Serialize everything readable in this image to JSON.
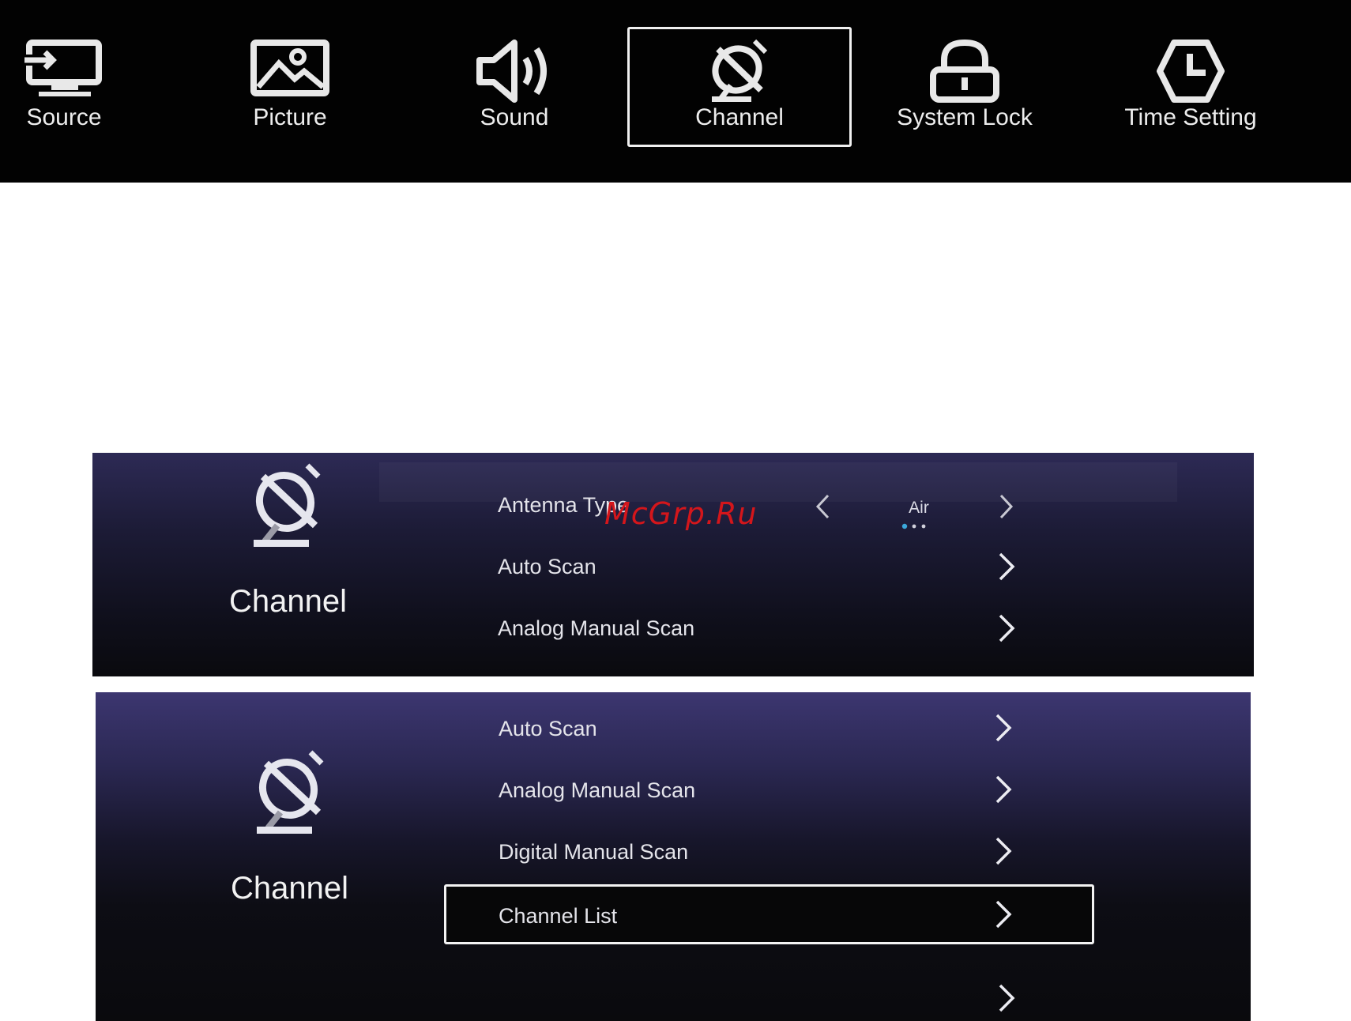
{
  "top_menu": {
    "tabs": [
      {
        "label": "Source",
        "icon": "source-input-icon"
      },
      {
        "label": "Picture",
        "icon": "picture-icon"
      },
      {
        "label": "Sound",
        "icon": "speaker-icon"
      },
      {
        "label": "Channel",
        "icon": "satellite-dish-icon",
        "selected": true
      },
      {
        "label": "System Lock",
        "icon": "lock-icon"
      },
      {
        "label": "Time Setting",
        "icon": "clock-icon"
      }
    ]
  },
  "channel_panel_1": {
    "title": "Channel",
    "icon": "satellite-dish-icon",
    "items": [
      {
        "label": "Antenna Type",
        "value": "Air",
        "type": "selector"
      },
      {
        "label": "Auto Scan",
        "type": "submenu"
      },
      {
        "label": "Analog Manual Scan",
        "type": "submenu"
      }
    ]
  },
  "channel_panel_2": {
    "title": "Channel",
    "icon": "satellite-dish-icon",
    "items": [
      {
        "label": "Auto Scan",
        "type": "submenu"
      },
      {
        "label": "Analog Manual Scan",
        "type": "submenu"
      },
      {
        "label": "Digital Manual Scan",
        "type": "submenu"
      },
      {
        "label": "Channel List",
        "type": "submenu",
        "selected": true
      },
      {
        "label": "",
        "type": "submenu"
      }
    ]
  },
  "watermark": "McGrp.Ru",
  "colors": {
    "menu_bar_bg": "#020202",
    "panel_top": "#3c3670",
    "panel_bottom": "#0a0a0d",
    "text": "#ededed",
    "selection_border": "#f3f3f3",
    "option_dot_active": "#3ba7d9",
    "watermark": "#d4161b"
  }
}
